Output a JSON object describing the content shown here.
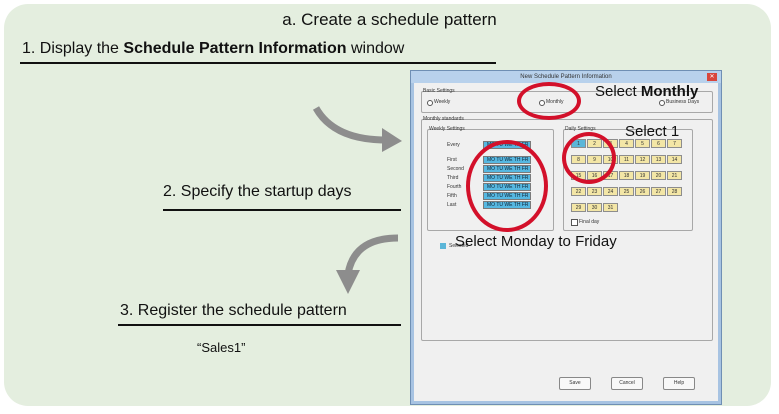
{
  "heading": "a. Create a schedule pattern",
  "steps": {
    "s1_prefix": "1. Display the ",
    "s1_bold": "Schedule Pattern Information",
    "s1_suffix": " window",
    "s2": "2. Specify the startup days",
    "s3": "3. Register the schedule pattern",
    "s3_note": "“Sales1”"
  },
  "callouts": {
    "monthly_prefix": "Select ",
    "monthly_bold": "Monthly",
    "select_one": "Select 1",
    "mon_fri": "Select Monday to Friday"
  },
  "window": {
    "title": "New Schedule Pattern Information",
    "basic_settings": "Basic Settings",
    "opt_weekly": "Weekly",
    "opt_monthly": "Monthly",
    "opt_business": "Business Days",
    "monthly_standards": "Monthly standards",
    "weekly_settings": "Weekly Settings",
    "daily_settings": "Daily Settings",
    "row_labels": [
      "Every",
      "First",
      "Second",
      "Third",
      "Fourth",
      "Fifth",
      "Last"
    ],
    "day_strip": "MO TU WE TH FR",
    "calendar_days": [
      "1",
      "2",
      "3",
      "4",
      "5",
      "6",
      "7",
      "8",
      "9",
      "10",
      "11",
      "12",
      "13",
      "14",
      "15",
      "16",
      "17",
      "18",
      "19",
      "20",
      "21",
      "22",
      "23",
      "24",
      "25",
      "26",
      "27",
      "28",
      "29",
      "30",
      "31"
    ],
    "last_day": "Final day",
    "selected_legend": "Selected",
    "buttons": {
      "save": "Save",
      "cancel": "Cancel",
      "help": "Help"
    }
  },
  "colors": {
    "panel": "#e4eedf",
    "ring": "#d3102a",
    "selected": "#5bb6d8",
    "cell": "#f3e6a6"
  }
}
